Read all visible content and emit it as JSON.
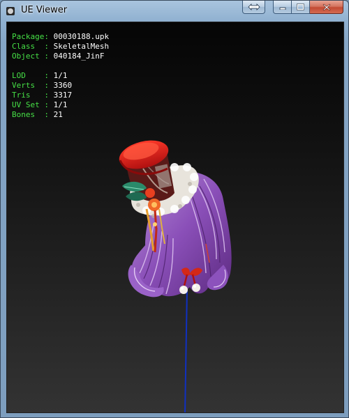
{
  "window": {
    "title": "UE Viewer"
  },
  "info_group1": [
    {
      "label": "Package: ",
      "value": "00030188.upk"
    },
    {
      "label": "Class  : ",
      "value": "SkeletalMesh"
    },
    {
      "label": "Object : ",
      "value": "040184_JinF"
    }
  ],
  "info_group2": [
    {
      "label": "LOD    : ",
      "value": "1/1"
    },
    {
      "label": "Verts  : ",
      "value": "3360"
    },
    {
      "label": "Tris   : ",
      "value": "3317"
    },
    {
      "label": "UV Set : ",
      "value": "1/1"
    },
    {
      "label": "Bones  : ",
      "value": "21"
    }
  ],
  "colors": {
    "label": "#46e046",
    "value": "#ffffff",
    "bone_line": "#1030c0"
  },
  "icons": [
    "app-icon",
    "swap-icon",
    "minimize-icon",
    "maximize-icon",
    "close-icon"
  ]
}
